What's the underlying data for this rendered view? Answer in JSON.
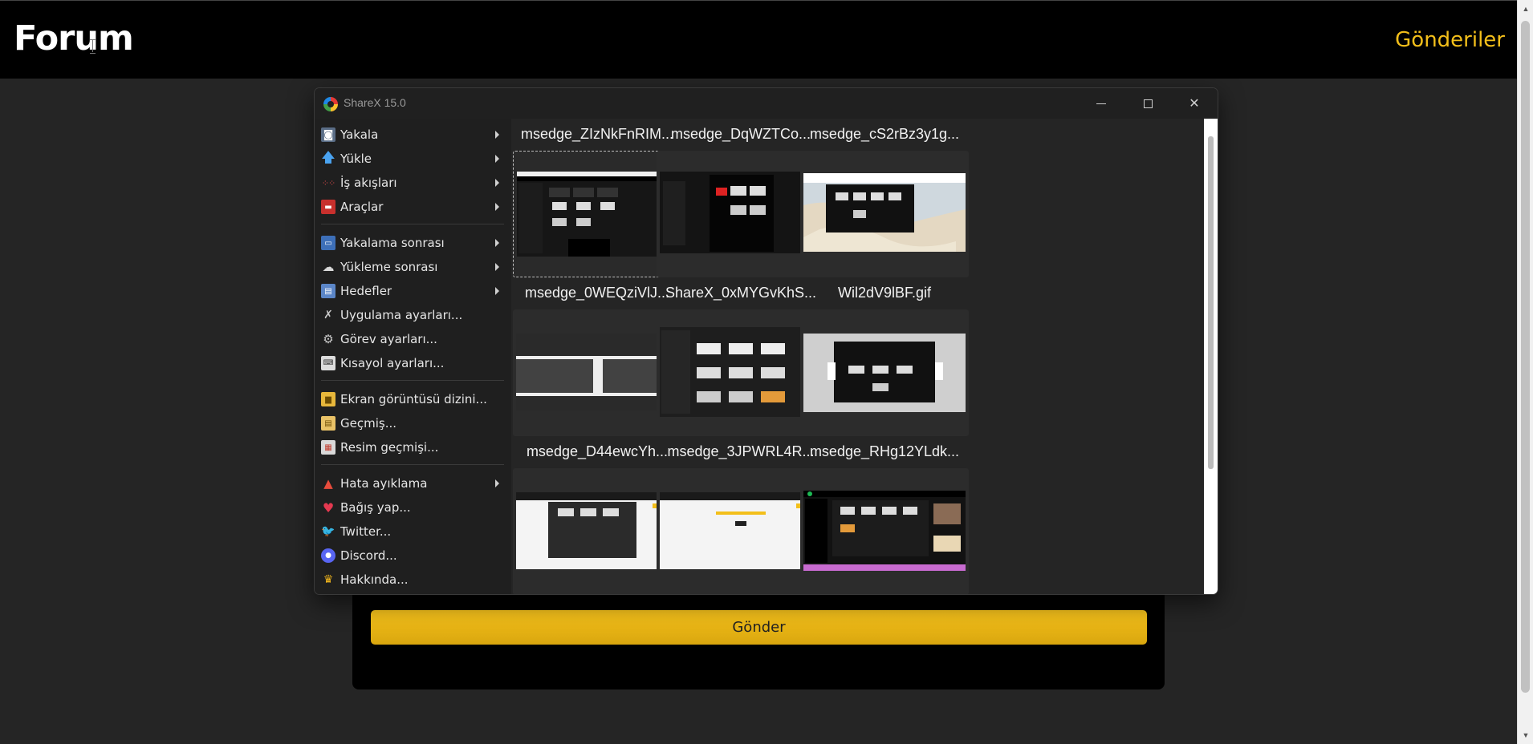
{
  "page": {
    "title": "Forum",
    "nav_link": "Gönderiler",
    "submit_label": "Gönder"
  },
  "window": {
    "title": "ShareX 15.0",
    "controls": [
      "minimize",
      "maximize",
      "close"
    ]
  },
  "menu": {
    "items": [
      {
        "label": "Yakala",
        "icon": "camera-icon",
        "submenu": true
      },
      {
        "label": "Yükle",
        "icon": "upload-arrow-icon",
        "submenu": true
      },
      {
        "label": "İş akışları",
        "icon": "workflow-dots-icon",
        "submenu": true
      },
      {
        "label": "Araçlar",
        "icon": "toolbox-icon",
        "submenu": true
      },
      {
        "label": "Yakalama sonrası",
        "icon": "after-capture-icon",
        "submenu": true
      },
      {
        "label": "Yükleme sonrası",
        "icon": "after-upload-cloud-icon",
        "submenu": true
      },
      {
        "label": "Hedefler",
        "icon": "destinations-icon",
        "submenu": true
      },
      {
        "label": "Uygulama ayarları...",
        "icon": "wrench-screwdriver-icon",
        "submenu": false
      },
      {
        "label": "Görev ayarları...",
        "icon": "gear-icon",
        "submenu": false
      },
      {
        "label": "Kısayol ayarları...",
        "icon": "keyboard-icon",
        "submenu": false
      },
      {
        "label": "Ekran görüntüsü dizini...",
        "icon": "folder-icon",
        "submenu": false
      },
      {
        "label": "Geçmiş...",
        "icon": "history-icon",
        "submenu": false
      },
      {
        "label": "Resim geçmişi...",
        "icon": "image-history-icon",
        "submenu": false
      },
      {
        "label": "Hata ayıklama",
        "icon": "debug-cone-icon",
        "submenu": true
      },
      {
        "label": "Bağış yap...",
        "icon": "heart-icon",
        "submenu": false
      },
      {
        "label": "Twitter...",
        "icon": "twitter-icon",
        "submenu": false
      },
      {
        "label": "Discord...",
        "icon": "discord-icon",
        "submenu": false
      },
      {
        "label": "Hakkında...",
        "icon": "crown-icon",
        "submenu": false
      }
    ]
  },
  "history": {
    "tiles": [
      {
        "name": "msedge_ZIzNkFnRIM...",
        "selected": true
      },
      {
        "name": "msedge_DqWZTCo...",
        "selected": false
      },
      {
        "name": "msedge_cS2rBz3y1g...",
        "selected": false
      },
      {
        "name": "msedge_0WEQziVlJ...",
        "selected": false
      },
      {
        "name": "ShareX_0xMYGvKhS...",
        "selected": false
      },
      {
        "name": "Wil2dV9lBF.gif",
        "selected": false
      },
      {
        "name": "msedge_D44ewcYh...",
        "selected": false
      },
      {
        "name": "msedge_3JPWRL4R...",
        "selected": false
      },
      {
        "name": "msedge_RHg12YLdk...",
        "selected": false
      }
    ]
  },
  "colors": {
    "accent": "#f3bf1a",
    "page_bg": "#252525",
    "header_bg": "#000000",
    "window_bg": "#1f1f1f"
  }
}
